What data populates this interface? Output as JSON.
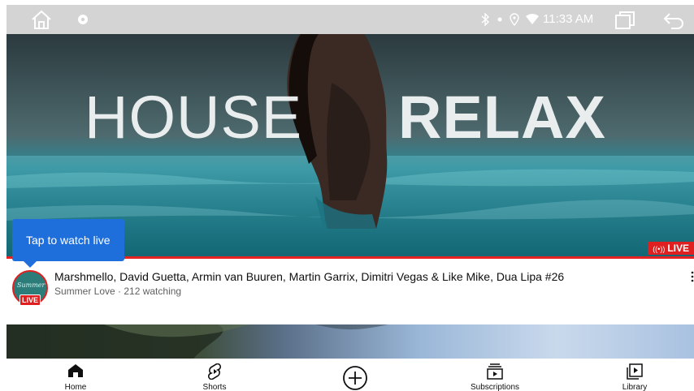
{
  "status_bar": {
    "time": "11:33 AM",
    "icons": [
      "home-icon",
      "gear-icon",
      "bluetooth-icon",
      "dot-icon",
      "location-icon",
      "wifi-icon",
      "recent-apps-icon",
      "back-icon"
    ]
  },
  "hero": {
    "thumbnail_text_left": "HOUSE",
    "thumbnail_text_right": "RELAX",
    "live_badge": "LIVE",
    "tooltip": "Tap to watch live"
  },
  "video": {
    "title": "Marshmello, David Guetta, Armin van Buuren, Martin Garrix, Dimitri Vegas & Like Mike, Dua Lipa #26",
    "meta": "Summer Love · 212 watching",
    "avatar_text": "Summer",
    "avatar_live": "LIVE"
  },
  "bottom_nav": {
    "items": [
      {
        "label": "Home",
        "icon": "home-filled-icon"
      },
      {
        "label": "Shorts",
        "icon": "shorts-icon"
      },
      {
        "label": "",
        "icon": "create-plus-icon"
      },
      {
        "label": "Subscriptions",
        "icon": "subscriptions-icon"
      },
      {
        "label": "Library",
        "icon": "library-icon"
      }
    ]
  },
  "colors": {
    "status_bar": "#d4d4d4",
    "live_red": "#e02020",
    "tooltip_blue": "#1e6fdc",
    "title_text": "#0f0f0f",
    "meta_text": "#606060"
  }
}
